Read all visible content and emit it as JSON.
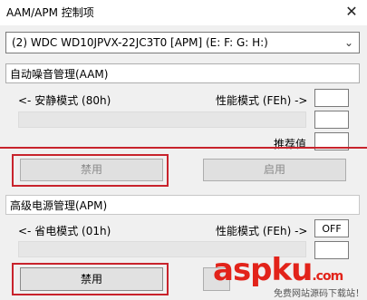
{
  "window": {
    "title": "AAM/APM 控制项",
    "close_glyph": "✕"
  },
  "drive_select": {
    "value": "(2) WDC WD10JPVX-22JC3T0 [APM] (E: F: G: H:)",
    "chevron": "⌄"
  },
  "aam": {
    "header": "自动噪音管理(AAM)",
    "quiet_label": "<- 安静模式 (80h)",
    "perf_label": "性能模式 (FEh) ->",
    "perf_value": "",
    "current_value": "",
    "recommend_label": "推荐值",
    "recommend_value": "",
    "disable_button": "禁用",
    "enable_button": "启用"
  },
  "apm": {
    "header": "高级电源管理(APM)",
    "power_label": "<- 省电模式 (01h)",
    "perf_label": "性能模式 (FEh) ->",
    "perf_value": "OFF",
    "disable_button": "禁用"
  },
  "watermark": {
    "text": "aspku",
    "suffix": ".com",
    "sub": "免费网站源码下载站！"
  },
  "colors": {
    "highlight_red": "#c8232c",
    "window_bg": "#f0f0f0"
  }
}
